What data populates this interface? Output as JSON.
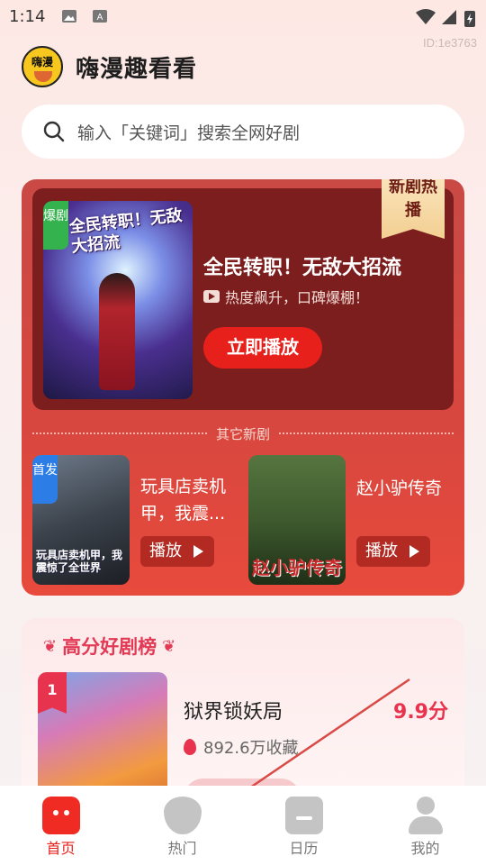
{
  "status": {
    "time": "1:14",
    "id_text": "ID:1e3763"
  },
  "app": {
    "logo_text": "嗨漫",
    "title": "嗨漫趣看看"
  },
  "search": {
    "placeholder": "输入「关键词」搜索全网好剧"
  },
  "hot": {
    "ribbon": "新剧热播",
    "poster_tag": "爆剧",
    "poster_title": "全民转职！无敌大招流",
    "name": "全民转职！无敌大招流",
    "subtitle": "热度飙升，口碑爆棚！",
    "play_button": "立即播放",
    "other_label": "其它新剧",
    "others": [
      {
        "tag": "首发",
        "poster_text": "玩具店卖机甲，我震惊了全世界",
        "name": "玩具店卖机甲，我震...",
        "play": "播放"
      },
      {
        "tag": "",
        "poster_text": "赵小驴传奇",
        "name": "赵小驴传奇",
        "play": "播放"
      }
    ]
  },
  "ranking": {
    "title": "高分好剧榜",
    "items": [
      {
        "rank": "1",
        "name": "狱界锁妖局",
        "score": "9.9分",
        "favorites": "892.6万收藏"
      }
    ]
  },
  "tabs": [
    {
      "label": "首页",
      "icon": "home-icon",
      "active": true
    },
    {
      "label": "热门",
      "icon": "fire-icon",
      "active": false
    },
    {
      "label": "日历",
      "icon": "calendar-icon",
      "active": false
    },
    {
      "label": "我的",
      "icon": "user-icon",
      "active": false
    }
  ],
  "colors": {
    "accent": "#e8201b",
    "rank": "#e8334f",
    "card": "#d8473f"
  }
}
